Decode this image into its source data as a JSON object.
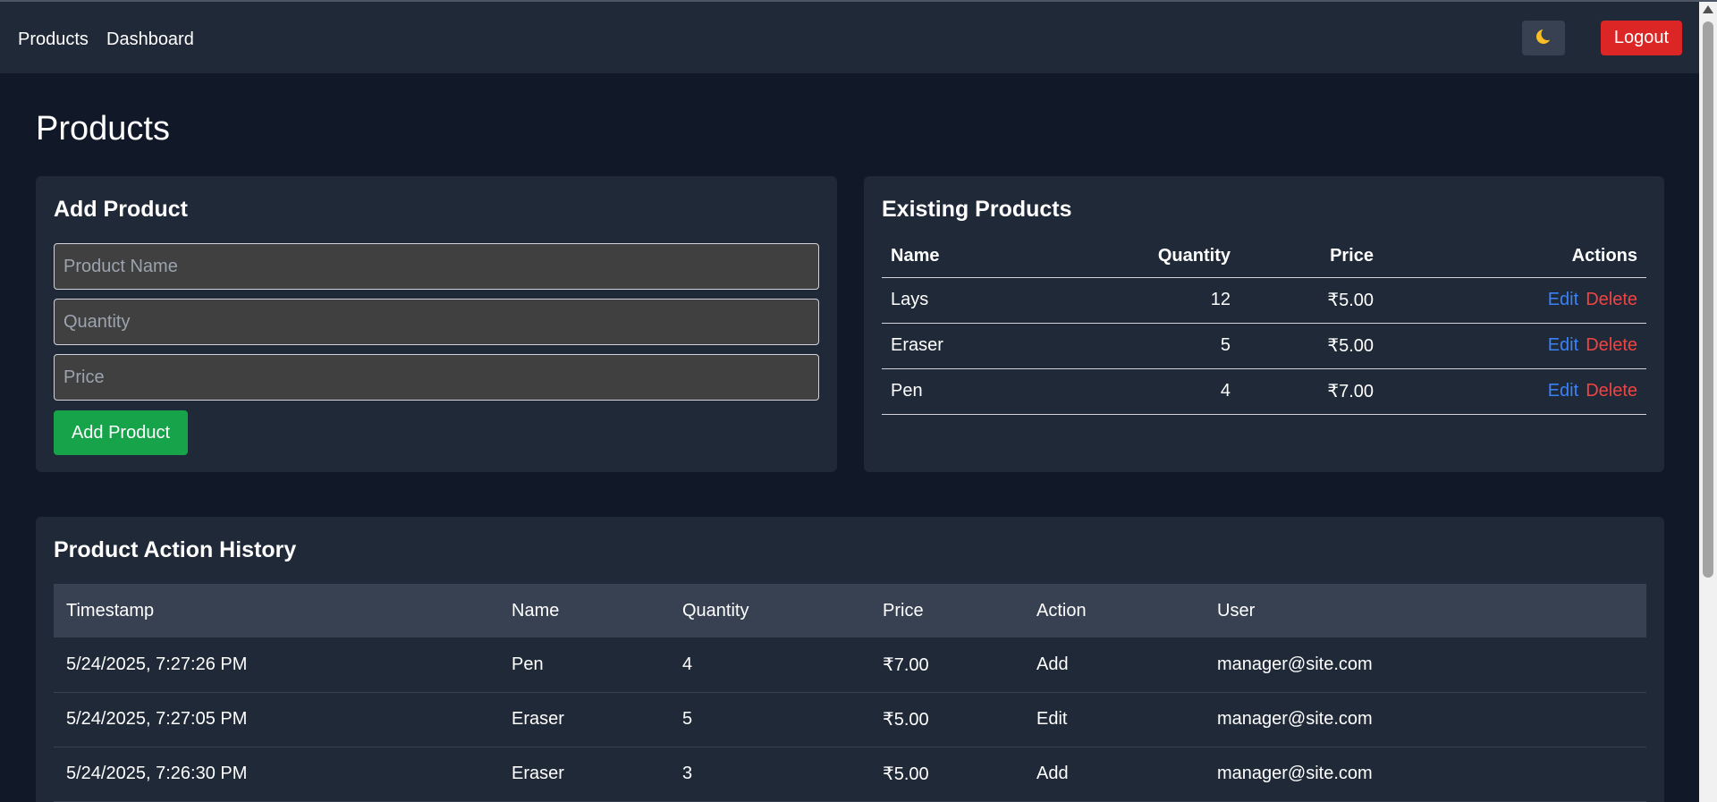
{
  "nav": {
    "links": [
      "Products",
      "Dashboard"
    ],
    "theme_icon": "moon-icon",
    "logout_label": "Logout"
  },
  "page": {
    "title": "Products"
  },
  "add_product": {
    "title": "Add Product",
    "name_placeholder": "Product Name",
    "quantity_placeholder": "Quantity",
    "price_placeholder": "Price",
    "submit_label": "Add Product"
  },
  "existing": {
    "title": "Existing Products",
    "columns": [
      "Name",
      "Quantity",
      "Price",
      "Actions"
    ],
    "edit_label": "Edit",
    "delete_label": "Delete",
    "rows": [
      {
        "name": "Lays",
        "quantity": "12",
        "price": "₹5.00"
      },
      {
        "name": "Eraser",
        "quantity": "5",
        "price": "₹5.00"
      },
      {
        "name": "Pen",
        "quantity": "4",
        "price": "₹7.00"
      }
    ]
  },
  "history": {
    "title": "Product Action History",
    "columns": [
      "Timestamp",
      "Name",
      "Quantity",
      "Price",
      "Action",
      "User"
    ],
    "rows": [
      {
        "timestamp": "5/24/2025, 7:27:26 PM",
        "name": "Pen",
        "quantity": "4",
        "price": "₹7.00",
        "action": "Add",
        "user": "manager@site.com"
      },
      {
        "timestamp": "5/24/2025, 7:27:05 PM",
        "name": "Eraser",
        "quantity": "5",
        "price": "₹5.00",
        "action": "Edit",
        "user": "manager@site.com"
      },
      {
        "timestamp": "5/24/2025, 7:26:30 PM",
        "name": "Eraser",
        "quantity": "3",
        "price": "₹5.00",
        "action": "Add",
        "user": "manager@site.com"
      }
    ]
  },
  "colors": {
    "page_bg": "#111827",
    "card_bg": "#1f2937",
    "add_button": "#16a34a",
    "logout_button": "#dc2626",
    "edit_link": "#3b82f6",
    "delete_link": "#ef4444"
  }
}
